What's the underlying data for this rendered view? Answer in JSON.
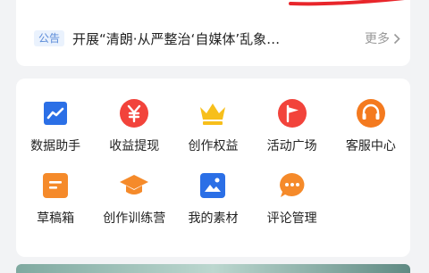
{
  "notice": {
    "badge": "公告",
    "text": "开展“清朗·从严整治‘自媒体’乱象…",
    "more": "更多"
  },
  "tools": {
    "row1": [
      {
        "label": "数据助手",
        "icon": "chart-trend-icon",
        "color": "#2b6fe6"
      },
      {
        "label": "收益提现",
        "icon": "yen-icon",
        "color": "#f2433b"
      },
      {
        "label": "创作权益",
        "icon": "crown-icon",
        "color": "#f7bf1b"
      },
      {
        "label": "活动广场",
        "icon": "flag-icon",
        "color": "#f2433b"
      },
      {
        "label": "客服中心",
        "icon": "headset-icon",
        "color": "#f47a1f"
      }
    ],
    "row2": [
      {
        "label": "草稿箱",
        "icon": "draft-icon",
        "color": "#f58a2a"
      },
      {
        "label": "创作训练营",
        "icon": "graduation-cap-icon",
        "color": "#f58a2a"
      },
      {
        "label": "我的素材",
        "icon": "image-icon",
        "color": "#2b6fe6"
      },
      {
        "label": "评论管理",
        "icon": "comment-icon",
        "color": "#f58a2a"
      }
    ]
  }
}
